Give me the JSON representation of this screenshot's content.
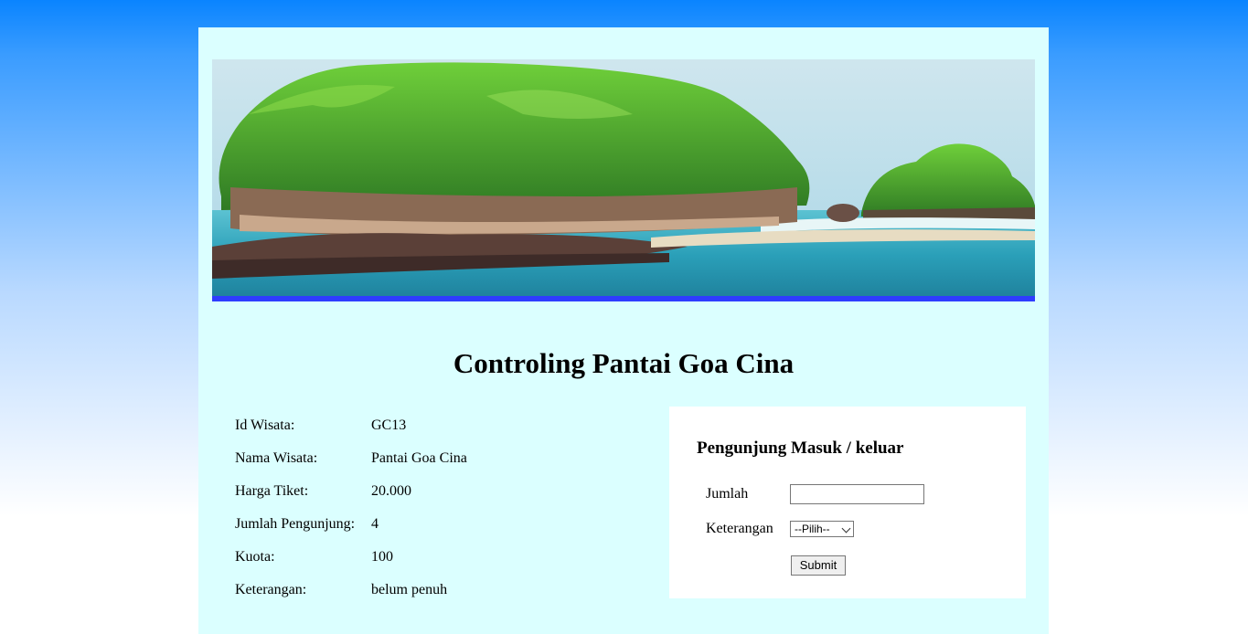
{
  "page": {
    "title": "Controling Pantai Goa Cina"
  },
  "banner": {
    "alt": "Pantai Goa Cina banner photo"
  },
  "info": [
    {
      "label": "Id Wisata:",
      "value": "GC13"
    },
    {
      "label": "Nama Wisata:",
      "value": "Pantai Goa Cina"
    },
    {
      "label": "Harga Tiket:",
      "value": "20.000"
    },
    {
      "label": "Jumlah Pengunjung:",
      "value": "4"
    },
    {
      "label": "Kuota:",
      "value": "100"
    },
    {
      "label": "Keterangan:",
      "value": "belum penuh"
    }
  ],
  "form": {
    "title": "Pengunjung Masuk / keluar",
    "jumlah_label": "Jumlah",
    "jumlah_value": "",
    "keterangan_label": "Keterangan",
    "keterangan_selected": "--Pilih--",
    "submit_label": "Submit"
  },
  "colors": {
    "page_gradient_top": "#0a84ff",
    "container_bg": "#dbffff",
    "panel_bg": "#ffffff",
    "banner_border": "#2f3cff"
  }
}
